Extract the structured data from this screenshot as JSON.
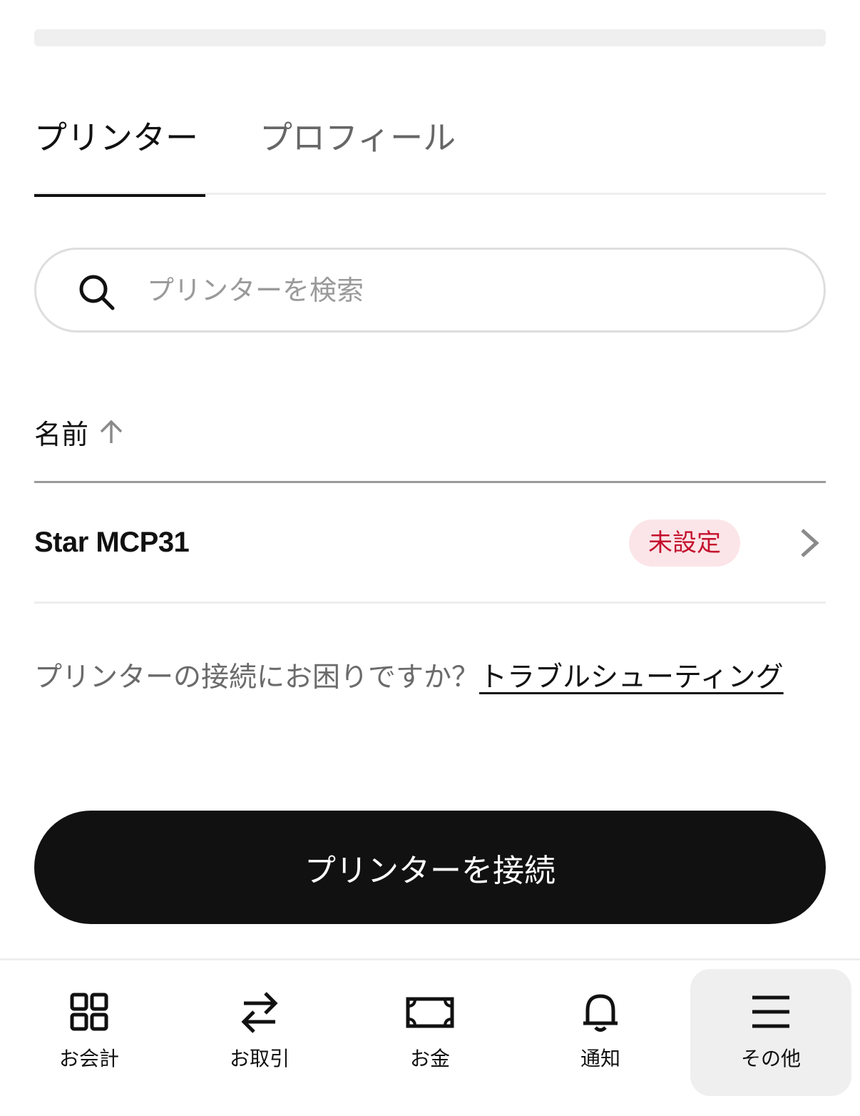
{
  "tabs": {
    "printer": "プリンター",
    "profile": "プロフィール"
  },
  "search": {
    "placeholder": "プリンターを検索",
    "value": ""
  },
  "table": {
    "column_name": "名前",
    "sort_direction": "ascending",
    "rows": [
      {
        "name": "Star MCP31",
        "status": "未設定"
      }
    ]
  },
  "help": {
    "question": "プリンターの接続にお困りですか？",
    "link": "トラブルシューティング"
  },
  "connect_button": "プリンターを接続",
  "bottom_nav": {
    "items": [
      {
        "label": "お会計",
        "icon": "grid-icon"
      },
      {
        "label": "お取引",
        "icon": "transfer-arrows-icon"
      },
      {
        "label": "お金",
        "icon": "banknote-icon"
      },
      {
        "label": "通知",
        "icon": "bell-icon"
      },
      {
        "label": "その他",
        "icon": "menu-icon"
      }
    ],
    "active": "その他"
  },
  "colors": {
    "badge_bg": "#fbe5e8",
    "badge_text": "#c4102d",
    "primary_button": "#111111"
  }
}
